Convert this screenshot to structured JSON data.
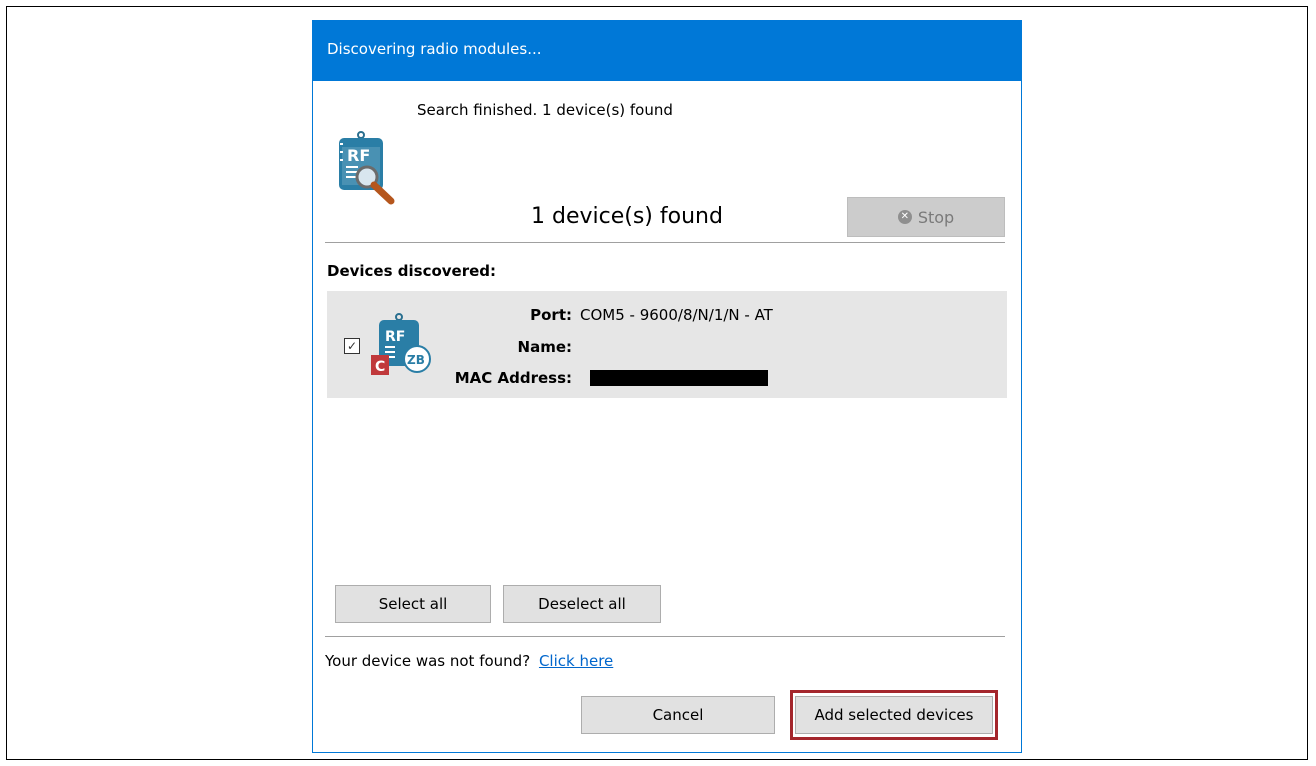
{
  "dialog": {
    "title": "Discovering radio modules...",
    "status": "Search finished. 1 device(s) found",
    "found_count": "1 device(s) found",
    "stop_label": "Stop"
  },
  "devices": {
    "header": "Devices discovered:",
    "items": [
      {
        "checked": true,
        "port_label": "Port:",
        "port_value": "COM5 - 9600/8/N/1/N - AT",
        "name_label": "Name:",
        "name_value": "",
        "mac_label": "MAC Address:",
        "mac_value_redacted": true
      }
    ]
  },
  "buttons": {
    "select_all": "Select all",
    "deselect_all": "Deselect all",
    "cancel": "Cancel",
    "add_selected": "Add selected devices"
  },
  "footer": {
    "not_found_text": "Your device was not found?",
    "click_here": "Click here"
  },
  "colors": {
    "titlebar": "#0078d7",
    "highlight": "#a4262c",
    "link": "#0066cc",
    "row_bg": "#e6e6e6"
  }
}
